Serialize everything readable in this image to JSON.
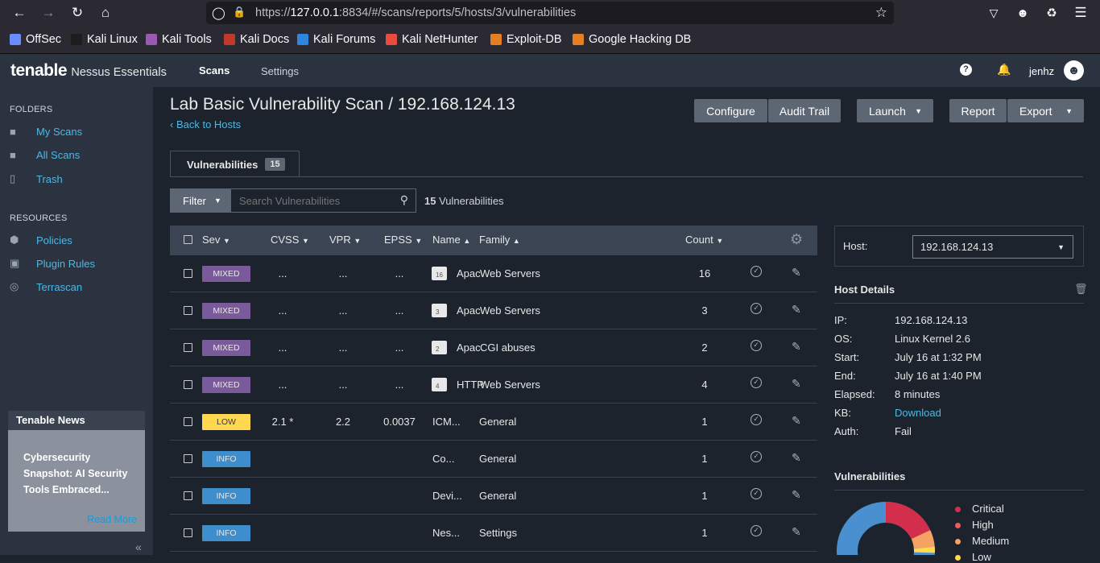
{
  "browser": {
    "url_prefix": "https://",
    "url_host": "127.0.0.1",
    "url_rest": ":8834/#/scans/reports/5/hosts/3/vulnerabilities",
    "bookmarks": [
      "OffSec",
      "Kali Linux",
      "Kali Tools",
      "Kali Docs",
      "Kali Forums",
      "Kali NetHunter",
      "Exploit-DB",
      "Google Hacking DB"
    ]
  },
  "header": {
    "logo": "tenable",
    "product": "Nessus Essentials",
    "nav_scans": "Scans",
    "nav_settings": "Settings",
    "username": "jenhz"
  },
  "sidebar": {
    "folders_head": "FOLDERS",
    "folders": [
      "My Scans",
      "All Scans",
      "Trash"
    ],
    "resources_head": "RESOURCES",
    "resources": [
      "Policies",
      "Plugin Rules",
      "Terrascan"
    ],
    "news_head": "Tenable News",
    "news_title": "Cybersecurity Snapshot: AI Security Tools Embraced...",
    "news_link": "Read More"
  },
  "main": {
    "title": "Lab Basic Vulnerability Scan / 192.168.124.13",
    "back": "Back to Hosts",
    "buttons": {
      "configure": "Configure",
      "audit": "Audit Trail",
      "launch": "Launch",
      "report": "Report",
      "export": "Export"
    },
    "tab_label": "Vulnerabilities",
    "tab_count": "15",
    "filter": "Filter",
    "search_placeholder": "Search Vulnerabilities",
    "count_num": "15",
    "count_label": "Vulnerabilities"
  },
  "table": {
    "headers": {
      "sev": "Sev",
      "cvss": "CVSS",
      "vpr": "VPR",
      "epss": "EPSS",
      "name": "Name",
      "family": "Family",
      "count": "Count"
    },
    "rows": [
      {
        "sev": "MIXED",
        "cvss": "...",
        "vpr": "...",
        "epss": "...",
        "folder": "16",
        "name": "Apac",
        "family": "Web Servers",
        "count": "16"
      },
      {
        "sev": "MIXED",
        "cvss": "...",
        "vpr": "...",
        "epss": "...",
        "folder": "3",
        "name": "Apac",
        "family": "Web Servers",
        "count": "3"
      },
      {
        "sev": "MIXED",
        "cvss": "...",
        "vpr": "...",
        "epss": "...",
        "folder": "2",
        "name": "Apac",
        "family": "CGI abuses",
        "count": "2"
      },
      {
        "sev": "MIXED",
        "cvss": "...",
        "vpr": "...",
        "epss": "...",
        "folder": "4",
        "name": "HTTP",
        "family": "Web Servers",
        "count": "4"
      },
      {
        "sev": "LOW",
        "cvss": "2.1 *",
        "vpr": "2.2",
        "epss": "0.0037",
        "folder": "",
        "name": "ICM...",
        "family": "General",
        "count": "1"
      },
      {
        "sev": "INFO",
        "cvss": "",
        "vpr": "",
        "epss": "",
        "folder": "",
        "name": "Co...",
        "family": "General",
        "count": "1"
      },
      {
        "sev": "INFO",
        "cvss": "",
        "vpr": "",
        "epss": "",
        "folder": "",
        "name": "Devi...",
        "family": "General",
        "count": "1"
      },
      {
        "sev": "INFO",
        "cvss": "",
        "vpr": "",
        "epss": "",
        "folder": "",
        "name": "Nes...",
        "family": "Settings",
        "count": "1"
      }
    ]
  },
  "host_panel": {
    "host_label": "Host:",
    "host_value": "192.168.124.13",
    "details_head": "Host Details",
    "details": [
      {
        "k": "IP:",
        "v": "192.168.124.13"
      },
      {
        "k": "OS:",
        "v": "Linux Kernel 2.6"
      },
      {
        "k": "Start:",
        "v": "July 16 at 1:32 PM"
      },
      {
        "k": "End:",
        "v": "July 16 at 1:40 PM"
      },
      {
        "k": "Elapsed:",
        "v": "8 minutes"
      },
      {
        "k": "KB:",
        "v": "Download"
      },
      {
        "k": "Auth:",
        "v": "Fail"
      }
    ],
    "vulns_head": "Vulnerabilities",
    "legend": [
      {
        "label": "Critical",
        "color": "#d32f4d"
      },
      {
        "label": "High",
        "color": "#ee5b5b"
      },
      {
        "label": "Medium",
        "color": "#f5a262"
      },
      {
        "label": "Low",
        "color": "#ffd84f"
      }
    ]
  }
}
